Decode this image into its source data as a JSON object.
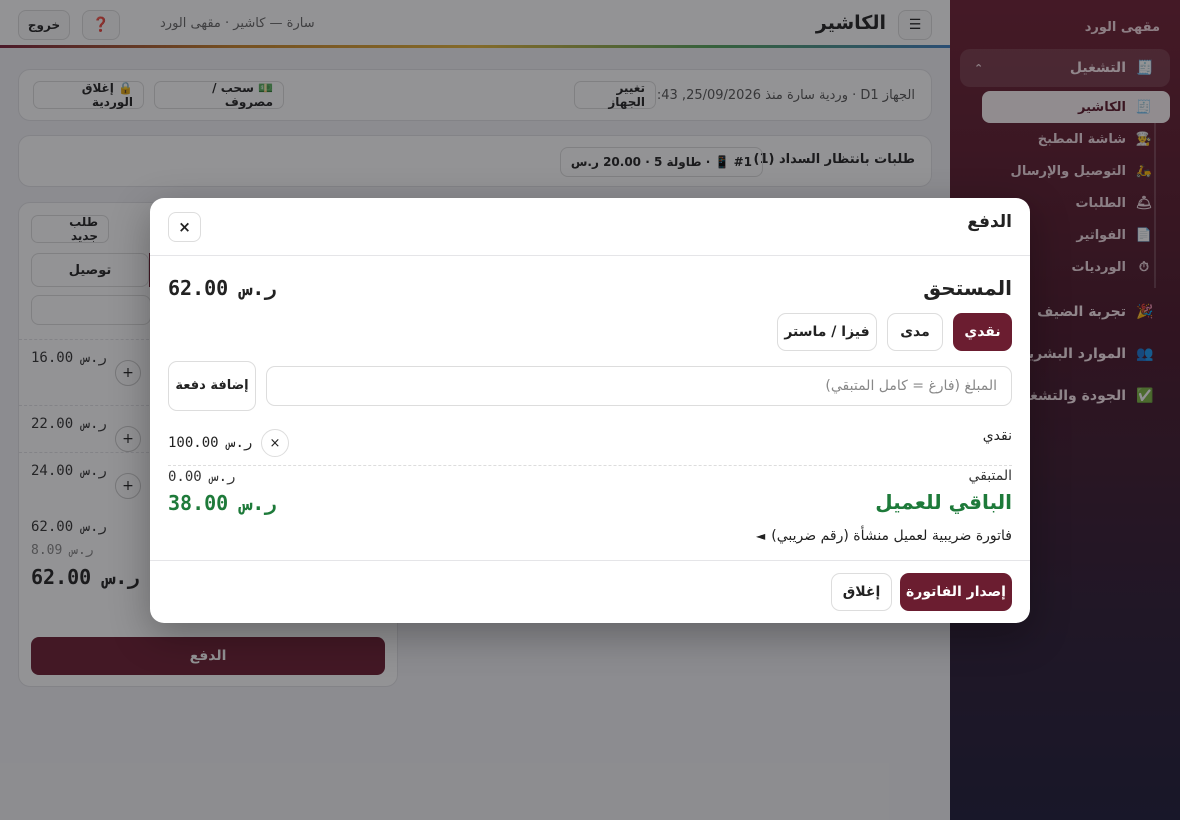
{
  "sidebar": {
    "brand": "مقهى الورد",
    "groups": [
      {
        "label": "التشغيل",
        "icon": "🧾",
        "expanded_icon": "⌃"
      },
      {
        "label": "تجربة الضيف",
        "icon": "🎉"
      },
      {
        "label": "الموارد البشرية",
        "icon": "👥"
      },
      {
        "label": "الجودة والتشغيل",
        "icon": "✅"
      }
    ],
    "items": [
      {
        "label": "الكاشير",
        "icon": "🧾"
      },
      {
        "label": "شاشة المطبخ",
        "icon": "👨‍🍳"
      },
      {
        "label": "التوصيل والإرسال",
        "icon": "🛵"
      },
      {
        "label": "الطلبات",
        "icon": "🛎"
      },
      {
        "label": "الفواتير",
        "icon": "📄"
      },
      {
        "label": "الورديات",
        "icon": "⏱"
      }
    ]
  },
  "topbar": {
    "menu_icon": "☰",
    "title": "الكاشير",
    "user_line": "سارة — كاشير · مقهى الورد",
    "help_icon": "❓",
    "logout": "خروج"
  },
  "shift": {
    "info": "الجهاز D1 · وردية سارة منذ 25/09/2026, 17:43",
    "change_device": "تغيير الجهاز",
    "cash_out": "💵 سحب / مصروف",
    "close_shift": "🔒 إغلاق الوردية"
  },
  "pending": {
    "title": "طلبات بانتظار السداد (1)",
    "chip": "#1 📱 · طاولة 5 · 20.00 ر.س"
  },
  "order_panel": {
    "new_order": "طلب جديد",
    "tab_delivery": "توصيل",
    "plus": "+",
    "line_prices": [
      "16.00 ر.س",
      "22.00 ر.س",
      "24.00 ر.س"
    ],
    "subtotal": "62.00 ر.س",
    "vat": "8.09 ر.س",
    "total": "62.00 ر.س",
    "pay": "الدفع"
  },
  "modal": {
    "title": "الدفع",
    "close_icon": "×",
    "due_label": "المستحق",
    "due_amount": "62.00 ر.س",
    "methods": [
      "نقدي",
      "مدى",
      "فيزا / ماستر"
    ],
    "amount_placeholder": "المبلغ (فارغ = كامل المتبقي)",
    "add_payment": "إضافة دفعة",
    "payments": [
      {
        "method": "نقدي",
        "amount": "100.00 ر.س",
        "remove_icon": "×"
      }
    ],
    "remaining_label": "المتبقي",
    "remaining_amount": "0.00 ر.س",
    "change_label": "الباقي للعميل",
    "change_amount": "38.00 ر.س",
    "invoice_toggle_icon": "◄",
    "invoice_toggle": "فاتورة ضريبية لعميل منشأة (رقم ضريبي)",
    "issue_invoice": "إصدار الفاتورة",
    "close": "إغلاق"
  },
  "colors": {
    "brand": "#6b1d30",
    "change_green": "#1e7a3a"
  }
}
